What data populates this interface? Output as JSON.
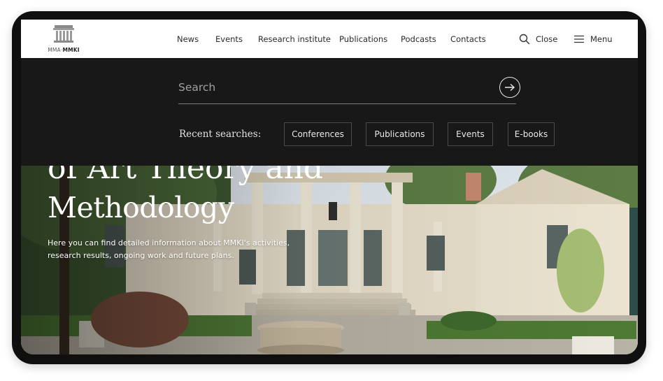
{
  "logo": {
    "text_left": "MMA",
    "text_right": "MMKI"
  },
  "nav": {
    "items": [
      "News",
      "Events",
      "Research institute",
      "Publications",
      "Podcasts",
      "Contacts"
    ],
    "close_label": "Close",
    "menu_label": "Menu"
  },
  "search": {
    "placeholder": "Search",
    "recent_label": "Recent searches:",
    "recent": [
      "Conferences",
      "Publications",
      "Events",
      "E-books"
    ]
  },
  "hero": {
    "title_top": "of Art Theory and",
    "title": "Methodology",
    "description": "Here you can find detailed information about MMKI's activities, research results, ongoing work and future plans."
  },
  "colors": {
    "search_panel": "#181818",
    "header": "#ffffff",
    "frame": "#0f0f0f"
  },
  "icons": [
    "logo-icon",
    "search-icon",
    "menu-icon",
    "arrow-right-icon"
  ]
}
